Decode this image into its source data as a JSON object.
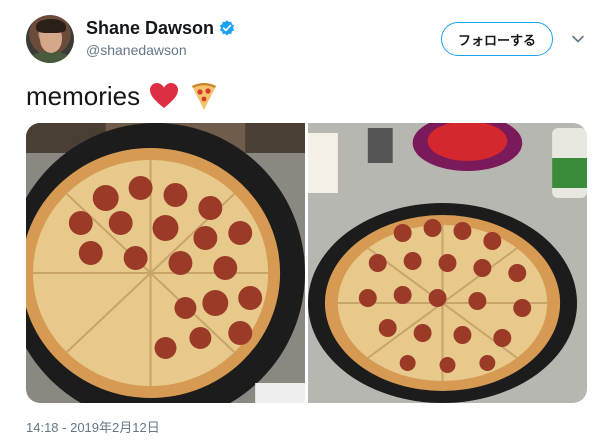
{
  "user": {
    "display_name": "Shane Dawson",
    "handle": "@shanedawson",
    "verified": true
  },
  "follow_button": {
    "label": "フォローする"
  },
  "tweet": {
    "text": "memories",
    "emojis": [
      "heart-emoji",
      "pizza-emoji"
    ]
  },
  "media": {
    "photos": [
      {
        "subject": "pepperoni and cheese pizza on a dark tray"
      },
      {
        "subject": "pepperoni pizza on a dark tray with cups and keys"
      }
    ]
  },
  "meta": {
    "timestamp": "14:18 - 2019年2月12日"
  },
  "colors": {
    "accent": "#1da1f2",
    "text": "#14171a",
    "secondary": "#657786",
    "heart": "#e0245e"
  }
}
